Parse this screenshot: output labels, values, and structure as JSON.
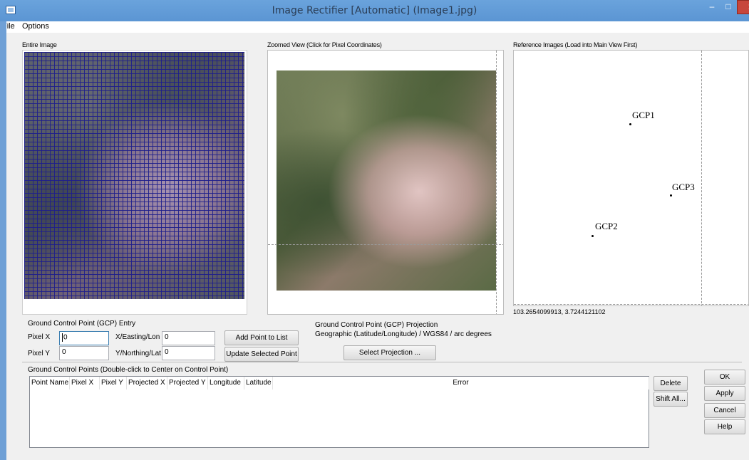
{
  "window": {
    "title": "Image Rectifier [Automatic] (Image1.jpg)",
    "minimize": "–",
    "maximize": "□",
    "close": "✕"
  },
  "menu": [
    "File",
    "Options"
  ],
  "panels": {
    "entire_image": "Entire Image",
    "zoomed_view": "Zoomed View (Click for Pixel Coordinates)",
    "reference_images": "Reference Images (Load into Main View First)"
  },
  "reference": {
    "gcps": [
      {
        "label": "GCP1"
      },
      {
        "label": "GCP3"
      },
      {
        "label": "GCP2"
      }
    ],
    "coordinate_readout": "103.2654099913, 3.7244121102"
  },
  "gcp_entry": {
    "heading": "Ground Control Point (GCP) Entry",
    "pixel_x_label": "Pixel X",
    "pixel_x_value": "0",
    "pixel_y_label": "Pixel Y",
    "pixel_y_value": "0",
    "easting_label": "X/Easting/Lon",
    "easting_value": "0",
    "northing_label": "Y/Northing/Lat",
    "northing_value": "0",
    "add_button": "Add Point to List",
    "update_button": "Update Selected Point"
  },
  "projection": {
    "heading": "Ground Control Point (GCP) Projection",
    "current": "Geographic (Latitude/Longitude) / WGS84 / arc degrees",
    "select_button": "Select Projection ..."
  },
  "gcp_list": {
    "heading": "Ground Control Points (Double-click to Center on Control Point)",
    "columns": [
      "Point Name",
      "Pixel X",
      "Pixel Y",
      "Projected X",
      "Projected Y",
      "Longitude",
      "Latitude",
      "Error"
    ],
    "delete_button": "Delete",
    "shift_button": "Shift All..."
  },
  "dialog_buttons": {
    "ok": "OK",
    "apply": "Apply",
    "cancel": "Cancel",
    "help": "Help"
  }
}
